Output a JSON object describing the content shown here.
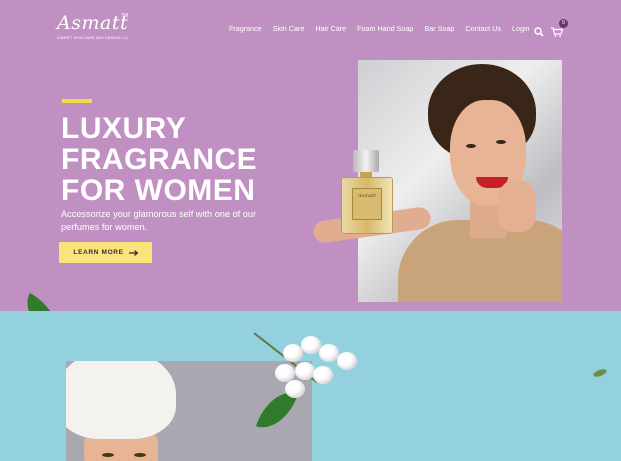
{
  "brand": {
    "name": "Asmatt",
    "tagline": "ASMATT SKIN CARE AND DESIGN LLC",
    "trademark": "TM"
  },
  "nav": {
    "items": [
      "Fragrance",
      "Skin Care",
      "Hair Care",
      "Foam Hand Soap",
      "Bar Soap",
      "Contact Us",
      "Login"
    ]
  },
  "header_icons": {
    "search": "search-icon",
    "cart": "cart-icon",
    "cart_count": "0"
  },
  "hero": {
    "headline_lines": [
      "LUXURY",
      "FRAGRANCE",
      "FOR WOMEN"
    ],
    "subtext": "Accessorize your glamorous self with one of our perfumes for women.",
    "cta_label": "LEARN MORE",
    "bottle_label": "Asmatt"
  },
  "colors": {
    "hero_bg": "#c190c2",
    "lower_bg": "#93d1de",
    "accent": "#f7d847",
    "cta_bg": "#f9e37a",
    "badge_bg": "#6d2f73"
  }
}
